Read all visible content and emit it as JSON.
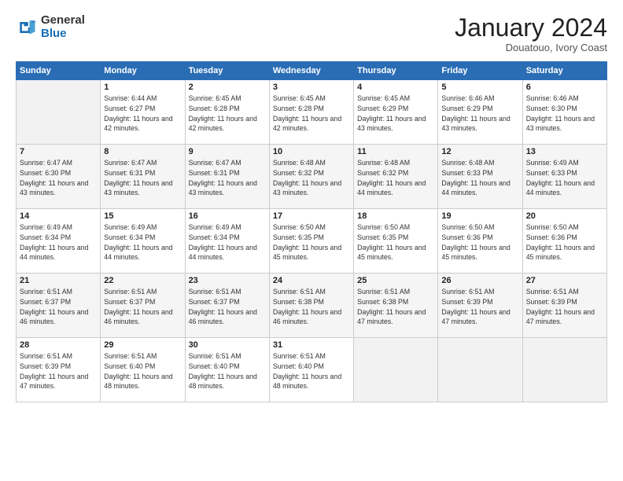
{
  "header": {
    "logo_general": "General",
    "logo_blue": "Blue",
    "month_title": "January 2024",
    "subtitle": "Douatouo, Ivory Coast"
  },
  "days_of_week": [
    "Sunday",
    "Monday",
    "Tuesday",
    "Wednesday",
    "Thursday",
    "Friday",
    "Saturday"
  ],
  "weeks": [
    [
      {
        "day": "",
        "empty": true
      },
      {
        "day": "1",
        "sunrise": "Sunrise: 6:44 AM",
        "sunset": "Sunset: 6:27 PM",
        "daylight": "Daylight: 11 hours and 42 minutes."
      },
      {
        "day": "2",
        "sunrise": "Sunrise: 6:45 AM",
        "sunset": "Sunset: 6:28 PM",
        "daylight": "Daylight: 11 hours and 42 minutes."
      },
      {
        "day": "3",
        "sunrise": "Sunrise: 6:45 AM",
        "sunset": "Sunset: 6:28 PM",
        "daylight": "Daylight: 11 hours and 42 minutes."
      },
      {
        "day": "4",
        "sunrise": "Sunrise: 6:45 AM",
        "sunset": "Sunset: 6:29 PM",
        "daylight": "Daylight: 11 hours and 43 minutes."
      },
      {
        "day": "5",
        "sunrise": "Sunrise: 6:46 AM",
        "sunset": "Sunset: 6:29 PM",
        "daylight": "Daylight: 11 hours and 43 minutes."
      },
      {
        "day": "6",
        "sunrise": "Sunrise: 6:46 AM",
        "sunset": "Sunset: 6:30 PM",
        "daylight": "Daylight: 11 hours and 43 minutes."
      }
    ],
    [
      {
        "day": "7",
        "sunrise": "Sunrise: 6:47 AM",
        "sunset": "Sunset: 6:30 PM",
        "daylight": "Daylight: 11 hours and 43 minutes."
      },
      {
        "day": "8",
        "sunrise": "Sunrise: 6:47 AM",
        "sunset": "Sunset: 6:31 PM",
        "daylight": "Daylight: 11 hours and 43 minutes."
      },
      {
        "day": "9",
        "sunrise": "Sunrise: 6:47 AM",
        "sunset": "Sunset: 6:31 PM",
        "daylight": "Daylight: 11 hours and 43 minutes."
      },
      {
        "day": "10",
        "sunrise": "Sunrise: 6:48 AM",
        "sunset": "Sunset: 6:32 PM",
        "daylight": "Daylight: 11 hours and 43 minutes."
      },
      {
        "day": "11",
        "sunrise": "Sunrise: 6:48 AM",
        "sunset": "Sunset: 6:32 PM",
        "daylight": "Daylight: 11 hours and 44 minutes."
      },
      {
        "day": "12",
        "sunrise": "Sunrise: 6:48 AM",
        "sunset": "Sunset: 6:33 PM",
        "daylight": "Daylight: 11 hours and 44 minutes."
      },
      {
        "day": "13",
        "sunrise": "Sunrise: 6:49 AM",
        "sunset": "Sunset: 6:33 PM",
        "daylight": "Daylight: 11 hours and 44 minutes."
      }
    ],
    [
      {
        "day": "14",
        "sunrise": "Sunrise: 6:49 AM",
        "sunset": "Sunset: 6:34 PM",
        "daylight": "Daylight: 11 hours and 44 minutes."
      },
      {
        "day": "15",
        "sunrise": "Sunrise: 6:49 AM",
        "sunset": "Sunset: 6:34 PM",
        "daylight": "Daylight: 11 hours and 44 minutes."
      },
      {
        "day": "16",
        "sunrise": "Sunrise: 6:49 AM",
        "sunset": "Sunset: 6:34 PM",
        "daylight": "Daylight: 11 hours and 44 minutes."
      },
      {
        "day": "17",
        "sunrise": "Sunrise: 6:50 AM",
        "sunset": "Sunset: 6:35 PM",
        "daylight": "Daylight: 11 hours and 45 minutes."
      },
      {
        "day": "18",
        "sunrise": "Sunrise: 6:50 AM",
        "sunset": "Sunset: 6:35 PM",
        "daylight": "Daylight: 11 hours and 45 minutes."
      },
      {
        "day": "19",
        "sunrise": "Sunrise: 6:50 AM",
        "sunset": "Sunset: 6:36 PM",
        "daylight": "Daylight: 11 hours and 45 minutes."
      },
      {
        "day": "20",
        "sunrise": "Sunrise: 6:50 AM",
        "sunset": "Sunset: 6:36 PM",
        "daylight": "Daylight: 11 hours and 45 minutes."
      }
    ],
    [
      {
        "day": "21",
        "sunrise": "Sunrise: 6:51 AM",
        "sunset": "Sunset: 6:37 PM",
        "daylight": "Daylight: 11 hours and 46 minutes."
      },
      {
        "day": "22",
        "sunrise": "Sunrise: 6:51 AM",
        "sunset": "Sunset: 6:37 PM",
        "daylight": "Daylight: 11 hours and 46 minutes."
      },
      {
        "day": "23",
        "sunrise": "Sunrise: 6:51 AM",
        "sunset": "Sunset: 6:37 PM",
        "daylight": "Daylight: 11 hours and 46 minutes."
      },
      {
        "day": "24",
        "sunrise": "Sunrise: 6:51 AM",
        "sunset": "Sunset: 6:38 PM",
        "daylight": "Daylight: 11 hours and 46 minutes."
      },
      {
        "day": "25",
        "sunrise": "Sunrise: 6:51 AM",
        "sunset": "Sunset: 6:38 PM",
        "daylight": "Daylight: 11 hours and 47 minutes."
      },
      {
        "day": "26",
        "sunrise": "Sunrise: 6:51 AM",
        "sunset": "Sunset: 6:39 PM",
        "daylight": "Daylight: 11 hours and 47 minutes."
      },
      {
        "day": "27",
        "sunrise": "Sunrise: 6:51 AM",
        "sunset": "Sunset: 6:39 PM",
        "daylight": "Daylight: 11 hours and 47 minutes."
      }
    ],
    [
      {
        "day": "28",
        "sunrise": "Sunrise: 6:51 AM",
        "sunset": "Sunset: 6:39 PM",
        "daylight": "Daylight: 11 hours and 47 minutes."
      },
      {
        "day": "29",
        "sunrise": "Sunrise: 6:51 AM",
        "sunset": "Sunset: 6:40 PM",
        "daylight": "Daylight: 11 hours and 48 minutes."
      },
      {
        "day": "30",
        "sunrise": "Sunrise: 6:51 AM",
        "sunset": "Sunset: 6:40 PM",
        "daylight": "Daylight: 11 hours and 48 minutes."
      },
      {
        "day": "31",
        "sunrise": "Sunrise: 6:51 AM",
        "sunset": "Sunset: 6:40 PM",
        "daylight": "Daylight: 11 hours and 48 minutes."
      },
      {
        "day": "",
        "empty": true
      },
      {
        "day": "",
        "empty": true
      },
      {
        "day": "",
        "empty": true
      }
    ]
  ]
}
